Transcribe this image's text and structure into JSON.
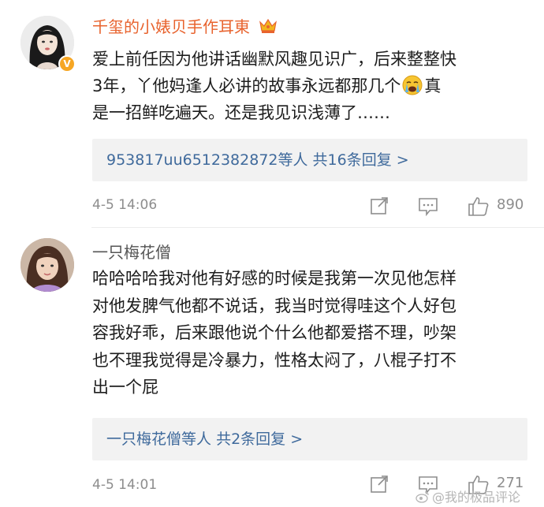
{
  "comments": [
    {
      "username": "千玺的小婊贝手作耳東",
      "content_lines": [
        "爱上前任因为他讲话幽默风趣见识广，后来整整快",
        "3年，丫他妈逢人必讲的故事永远都那几个",
        "是一招鲜吃遍天。还是我见识浅薄了……"
      ],
      "content_line2_tail": "真",
      "replies_names": "953817uu6512382872等人",
      "replies_count": "共16条回复 >",
      "time": "4-5 14:06",
      "like_count": "890"
    },
    {
      "username": "一只梅花僧",
      "content_lines": [
        "哈哈哈哈我对他有好感的时候是我第一次见他怎样",
        "对他发脾气他都不说话，我当时觉得哇这个人好包",
        "容我好乖，后来跟他说个什么他都爱搭不理，吵架",
        "也不理我觉得是冷暴力，性格太闷了，八棍子打不",
        "出一个屁"
      ],
      "replies_names": "一只梅花僧等人",
      "replies_count": "共2条回复 >",
      "time": "4-5 14:01",
      "like_count": "271"
    }
  ],
  "watermark": "@我的极品评论",
  "colors": {
    "username_vip": "#e8632e",
    "username": "#555555",
    "link": "#3f6a9c",
    "meta": "#8d8d8d",
    "reply_bg": "#f2f2f2",
    "vip_badge": "#f6a623"
  },
  "icons": {
    "share": "share-icon",
    "comment": "comment-icon",
    "like": "thumbs-up-icon",
    "crown": "crown-icon",
    "emoji": "crying-face-icon",
    "verified": "verified-v-icon"
  }
}
